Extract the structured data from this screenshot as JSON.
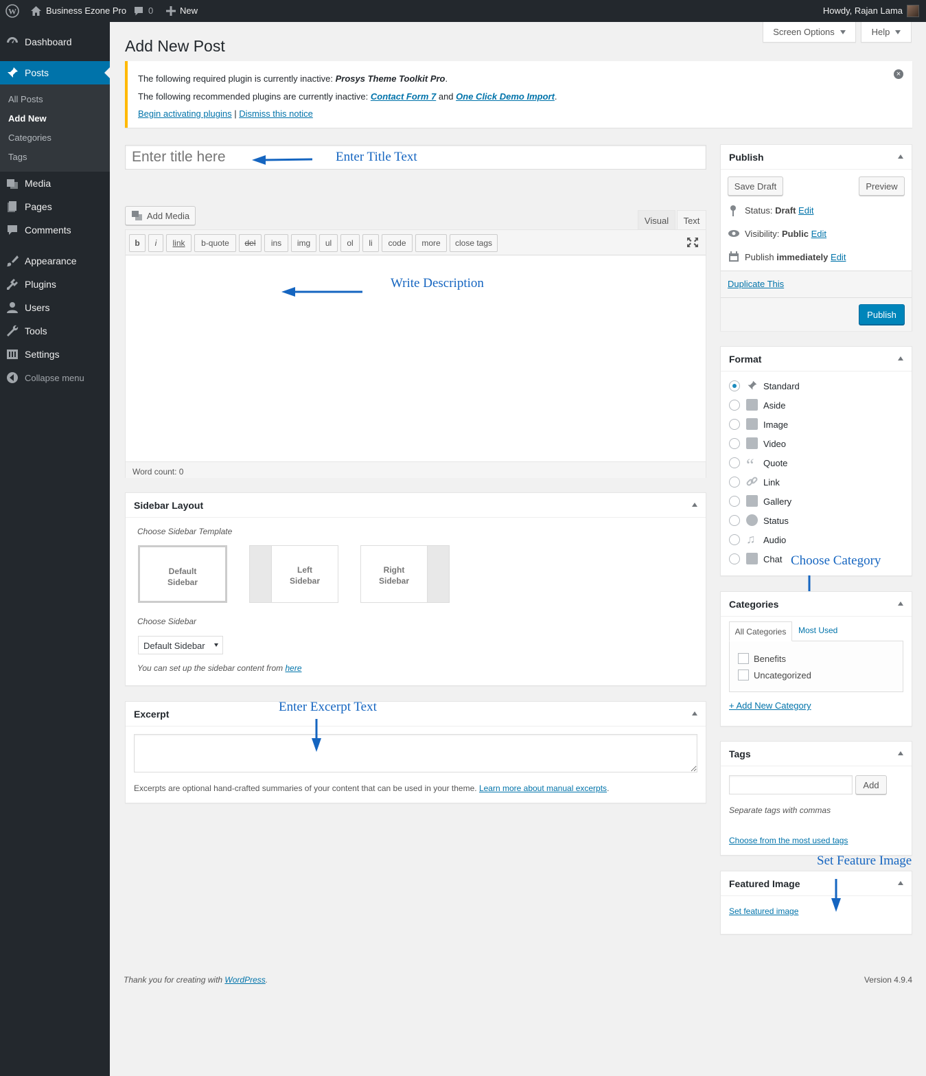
{
  "adminbar": {
    "site_name": "Business Ezone Pro",
    "comments_count": "0",
    "new_label": "New",
    "howdy": "Howdy, Rajan Lama"
  },
  "sidebar": {
    "items": [
      {
        "label": "Dashboard",
        "icon": "dashboard-icon"
      },
      {
        "label": "Posts",
        "icon": "pin-icon"
      },
      {
        "label": "Media",
        "icon": "media-icon"
      },
      {
        "label": "Pages",
        "icon": "pages-icon"
      },
      {
        "label": "Comments",
        "icon": "comment-icon"
      },
      {
        "label": "Appearance",
        "icon": "brush-icon"
      },
      {
        "label": "Plugins",
        "icon": "plugin-icon"
      },
      {
        "label": "Users",
        "icon": "user-icon"
      },
      {
        "label": "Tools",
        "icon": "wrench-icon"
      },
      {
        "label": "Settings",
        "icon": "settings-icon"
      },
      {
        "label": "Collapse menu",
        "icon": "collapse-icon"
      }
    ],
    "submenu": [
      "All Posts",
      "Add New",
      "Categories",
      "Tags"
    ]
  },
  "header": {
    "title": "Add New Post",
    "screen_options": "Screen Options",
    "help": "Help"
  },
  "notice": {
    "line1_prefix": "The following required plugin is currently inactive: ",
    "line1_plugin": "Prosys Theme Toolkit Pro",
    "line1_suffix": ".",
    "line2_prefix": "The following recommended plugins are currently inactive: ",
    "line2_link1": "Contact Form 7",
    "line2_and": " and ",
    "line2_link2": "One Click Demo Import",
    "line2_suffix": ".",
    "begin_link": "Begin activating plugins",
    "sep": " | ",
    "dismiss_link": "Dismiss this notice"
  },
  "editor": {
    "title_placeholder": "Enter title here",
    "add_media": "Add Media",
    "tab_visual": "Visual",
    "tab_text": "Text",
    "quicktags": [
      "b",
      "i",
      "link",
      "b-quote",
      "del",
      "ins",
      "img",
      "ul",
      "ol",
      "li",
      "code",
      "more",
      "close tags"
    ],
    "word_count": "Word count: 0"
  },
  "annotations": {
    "title": "Enter Title Text",
    "description": "Write Description",
    "category": "Choose Category",
    "excerpt": "Enter Excerpt Text",
    "feature": "Set Feature Image"
  },
  "sidebar_layout": {
    "title": "Sidebar Layout",
    "choose_template": "Choose Sidebar Template",
    "tiles": [
      {
        "line1": "Default",
        "line2": "Sidebar"
      },
      {
        "line1": "Left",
        "line2": "Sidebar"
      },
      {
        "line1": "Right",
        "line2": "Sidebar"
      }
    ],
    "choose_sidebar": "Choose Sidebar",
    "select_value": "Default Sidebar",
    "help_prefix": "You can set up the sidebar content from ",
    "help_link": "here"
  },
  "excerpt": {
    "title": "Excerpt",
    "help_prefix": "Excerpts are optional hand-crafted summaries of your content that can be used in your theme. ",
    "help_link": "Learn more about manual excerpts",
    "help_suffix": "."
  },
  "publish": {
    "title": "Publish",
    "save_draft": "Save Draft",
    "preview": "Preview",
    "status_label": "Status: ",
    "status_value": "Draft",
    "visibility_label": "Visibility: ",
    "visibility_value": "Public",
    "publish_label": "Publish ",
    "publish_value": "immediately",
    "edit": "Edit",
    "duplicate": "Duplicate This",
    "publish_button": "Publish"
  },
  "format": {
    "title": "Format",
    "options": [
      "Standard",
      "Aside",
      "Image",
      "Video",
      "Quote",
      "Link",
      "Gallery",
      "Status",
      "Audio",
      "Chat"
    ]
  },
  "categories": {
    "title": "Categories",
    "tab_all": "All Categories",
    "tab_most": "Most Used",
    "items": [
      "Benefits",
      "Uncategorized"
    ],
    "add_new": "+ Add New Category"
  },
  "tags": {
    "title": "Tags",
    "add": "Add",
    "help": "Separate tags with commas",
    "choose": "Choose from the most used tags"
  },
  "featured": {
    "title": "Featured Image",
    "set_link": "Set featured image"
  },
  "footer": {
    "thanks_prefix": "Thank you for creating with ",
    "thanks_link": "WordPress",
    "thanks_suffix": ".",
    "version": "Version 4.9.4"
  },
  "colors": {
    "admin_dark": "#23282d",
    "accent_blue": "#0073aa",
    "notice_warning": "#ffb900",
    "annotation_blue": "#1565c0"
  }
}
